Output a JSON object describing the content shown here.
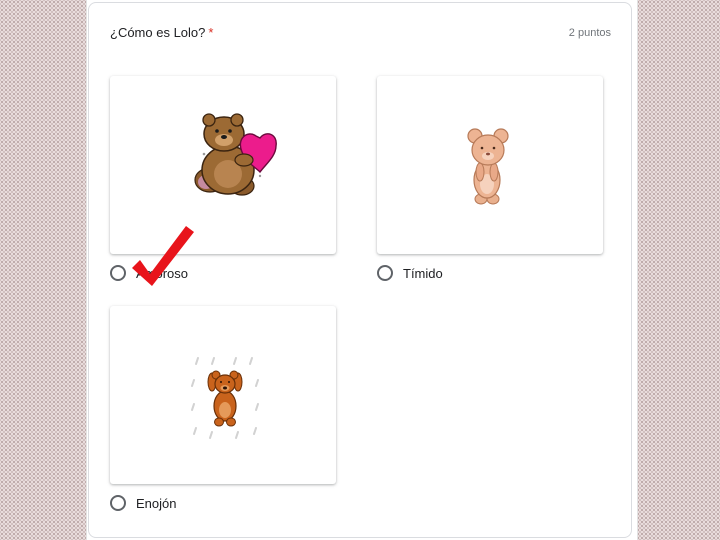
{
  "question": {
    "title": "¿Cómo es Lolo?",
    "required_mark": "*",
    "points": "2 puntos"
  },
  "options": [
    {
      "label": "Amoroso",
      "image_icon": "bear-with-heart-icon"
    },
    {
      "label": "Tímido",
      "image_icon": "shy-bear-icon"
    },
    {
      "label": "Enojón",
      "image_icon": "angry-bear-icon"
    }
  ],
  "annotation": {
    "icon": "red-checkmark-icon",
    "color": "#e8141b"
  },
  "colors": {
    "required": "#d93025",
    "heart": "#ec1c8c",
    "radio_border": "#5f6368"
  }
}
